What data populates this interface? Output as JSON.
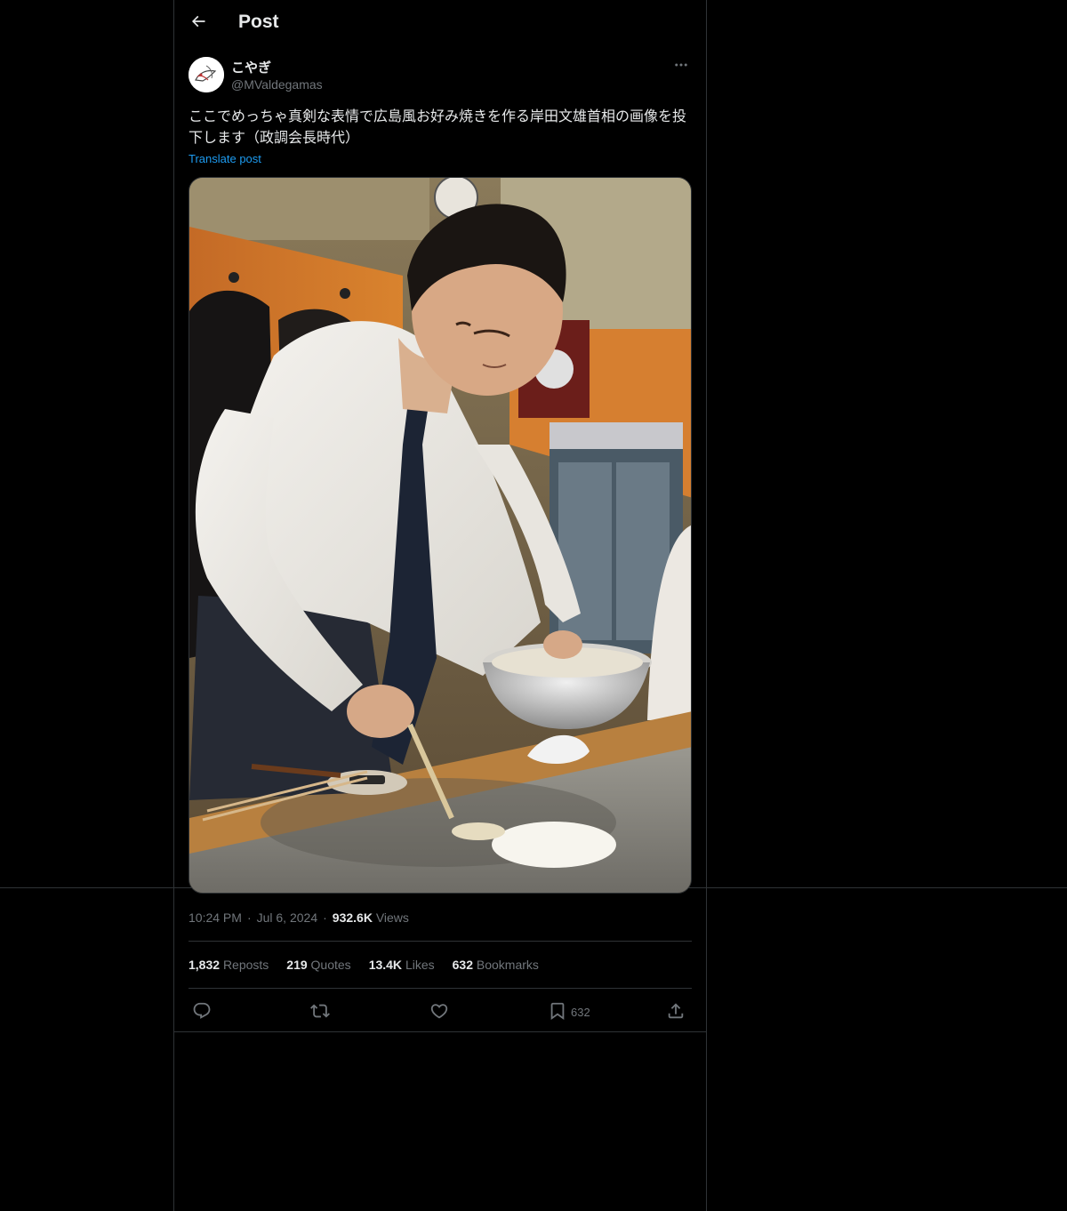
{
  "header": {
    "title": "Post"
  },
  "author": {
    "name": "こやぎ",
    "handle": "@MValdegamas"
  },
  "post": {
    "text": "ここでめっちゃ真剣な表情で広島風お好み焼きを作る岸田文雄首相の画像を投下します（政調会長時代）",
    "translate_label": "Translate post",
    "time": "10:24 PM",
    "date": "Jul 6, 2024",
    "views_count": "932.6K",
    "views_label": "Views"
  },
  "stats": {
    "reposts_count": "1,832",
    "reposts_label": "Reposts",
    "quotes_count": "219",
    "quotes_label": "Quotes",
    "likes_count": "13.4K",
    "likes_label": "Likes",
    "bookmarks_count": "632",
    "bookmarks_label": "Bookmarks"
  },
  "actions": {
    "bookmark_count": "632"
  },
  "icons": {
    "back": "arrow-left-icon",
    "more": "more-horizontal-icon",
    "reply": "reply-icon",
    "repost": "repost-icon",
    "like": "heart-icon",
    "bookmark": "bookmark-icon",
    "share": "share-icon"
  },
  "colors": {
    "background": "#000000",
    "text": "#e7e9ea",
    "secondary": "#71767b",
    "link": "#1d9bf0",
    "border": "#2f3336"
  }
}
